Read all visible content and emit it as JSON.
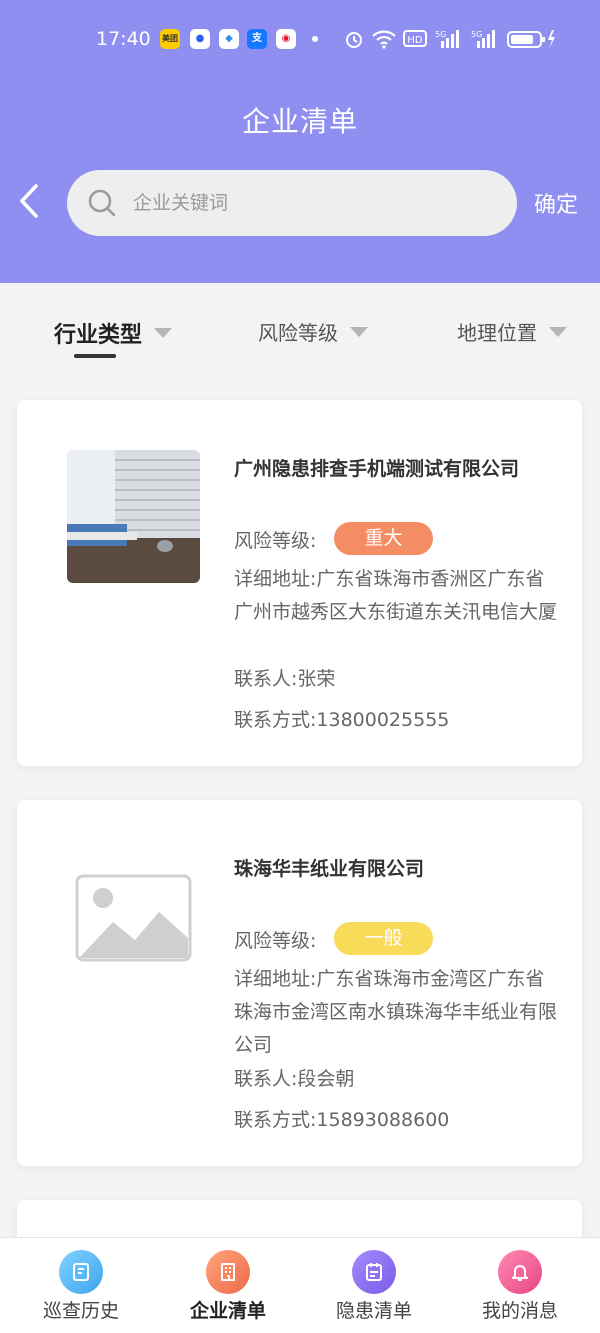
{
  "status_bar": {
    "time": "17:40",
    "app_icons": [
      "meituan-icon",
      "baidu-icon",
      "browser-icon",
      "alipay-icon",
      "weibo-icon"
    ],
    "system_icons": [
      "alarm-icon",
      "wifi-icon",
      "hd-icon",
      "signal-5g-icon",
      "signal-5g-icon",
      "battery-icon"
    ]
  },
  "header": {
    "title": "企业清单",
    "search_placeholder": "企业关键词",
    "confirm_label": "确定",
    "background": "#8f8ff2"
  },
  "filters": [
    {
      "label": "行业类型",
      "active": true
    },
    {
      "label": "风险等级",
      "active": false
    },
    {
      "label": "地理位置",
      "active": false
    }
  ],
  "companies": [
    {
      "name": "广州隐患排查手机端测试有限公司",
      "risk_label": "风险等级:",
      "risk_level": "重大",
      "risk_color": "#f58d64",
      "address_label": "详细地址:",
      "address": "广东省珠海市香洲区广东省广州市越秀区大东街道东关汛电信大厦",
      "contact_label": "联系人:",
      "contact": "张荣",
      "phone_label": "联系方式:",
      "phone": "13800025555",
      "image": "photo"
    },
    {
      "name": "珠海华丰纸业有限公司",
      "risk_label": "风险等级:",
      "risk_level": "一般",
      "risk_color": "#f9db5a",
      "address_label": "详细地址:",
      "address": "广东省珠海市金湾区广东省珠海市金湾区南水镇珠海华丰纸业有限公司",
      "contact_label": "联系人:",
      "contact": "段会朝",
      "phone_label": "联系方式:",
      "phone": "15893088600",
      "image": "placeholder"
    }
  ],
  "bottom_nav": [
    {
      "label": "巡查历史",
      "icon": "history-icon",
      "color": "#53b8f2",
      "active": false
    },
    {
      "label": "企业清单",
      "icon": "building-icon",
      "color": "#f4875e",
      "active": true
    },
    {
      "label": "隐患清单",
      "icon": "list-icon",
      "color": "#8f77f0",
      "active": false
    },
    {
      "label": "我的消息",
      "icon": "bell-icon",
      "color": "#ef5a93",
      "active": false
    }
  ]
}
